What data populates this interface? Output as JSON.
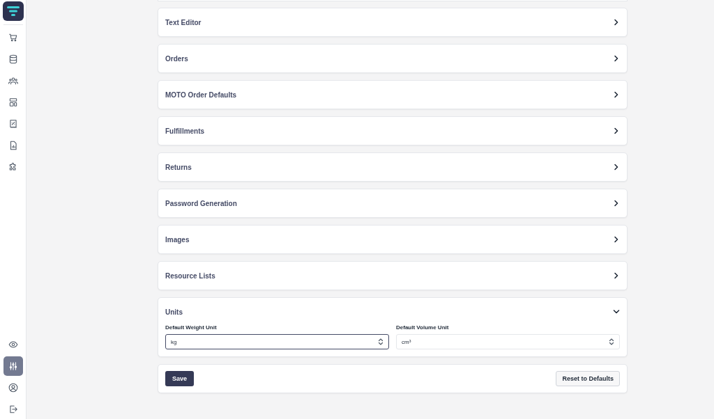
{
  "sidebar": {
    "items": [
      {
        "kind": "cart",
        "selected": false
      },
      {
        "kind": "database",
        "selected": false
      },
      {
        "kind": "users",
        "selected": false
      },
      {
        "kind": "layout",
        "selected": false
      },
      {
        "kind": "receipt",
        "selected": false
      },
      {
        "kind": "report",
        "selected": false
      },
      {
        "kind": "puzzle",
        "selected": false
      }
    ],
    "bottom_items": [
      {
        "kind": "eye",
        "selected": false
      },
      {
        "kind": "sliders",
        "selected": true
      },
      {
        "kind": "user",
        "selected": false
      },
      {
        "kind": "logout",
        "selected": false
      }
    ]
  },
  "sections": [
    {
      "title": "Text Editor",
      "expanded": false
    },
    {
      "title": "Orders",
      "expanded": false
    },
    {
      "title": "MOTO Order Defaults",
      "expanded": false
    },
    {
      "title": "Fulfillments",
      "expanded": false
    },
    {
      "title": "Returns",
      "expanded": false
    },
    {
      "title": "Password Generation",
      "expanded": false
    },
    {
      "title": "Images",
      "expanded": false
    },
    {
      "title": "Resource Lists",
      "expanded": false
    },
    {
      "title": "Units",
      "expanded": true,
      "fields": [
        {
          "label": "Default Weight Unit",
          "value": "kg",
          "focused": true
        },
        {
          "label": "Default Volume Unit",
          "value": "cm³",
          "focused": false
        }
      ]
    }
  ],
  "actions": {
    "save": "Save",
    "reset": "Reset to Defaults"
  }
}
